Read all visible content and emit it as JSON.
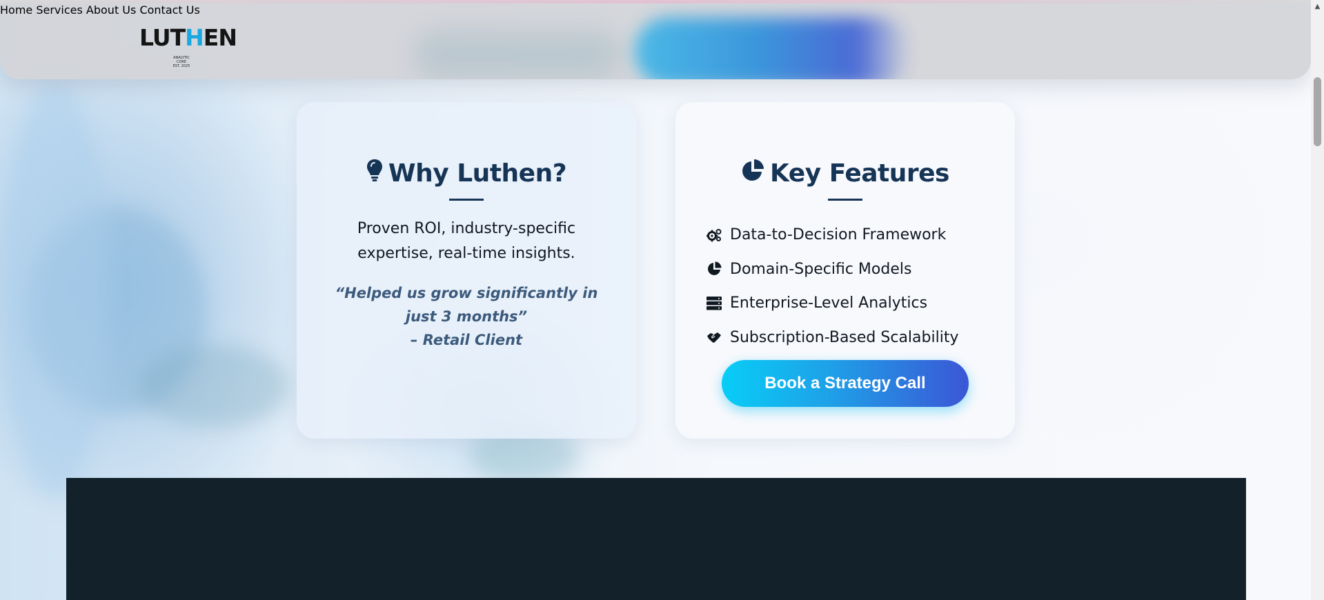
{
  "header": {
    "logo": {
      "word_a": "LUT",
      "word_b": "H",
      "word_c": "EN",
      "tagline_1": "ANALYTIC CORE",
      "tagline_2": "EST. 2025"
    },
    "nav": [
      {
        "label": "Home"
      },
      {
        "label": "Services"
      },
      {
        "label": "About Us"
      },
      {
        "label": "Contact Us"
      }
    ]
  },
  "why": {
    "title": "Why Luthen?",
    "icon": "lightbulb-icon",
    "tagline": "Proven ROI, industry-specific expertise, real-time insights.",
    "quote_line": "“Helped us grow significantly in just 3 months”",
    "quote_author": "– Retail Client"
  },
  "features": {
    "title": "Key Features",
    "icon": "chart-pie-icon",
    "items": [
      {
        "icon": "cogs-icon",
        "label": "Data-to-Decision Framework"
      },
      {
        "icon": "chart-pie-icon",
        "label": "Domain-Specific Models"
      },
      {
        "icon": "server-icon",
        "label": "Enterprise-Level Analytics"
      },
      {
        "icon": "handshake-icon",
        "label": "Subscription-Based Scalability"
      }
    ],
    "cta_label": "Book a Strategy Call"
  },
  "colors": {
    "brand_dark": "#163556",
    "accent_cyan": "#08cdf7",
    "accent_indigo": "#3b56d6",
    "dark_band": "#12212a"
  }
}
